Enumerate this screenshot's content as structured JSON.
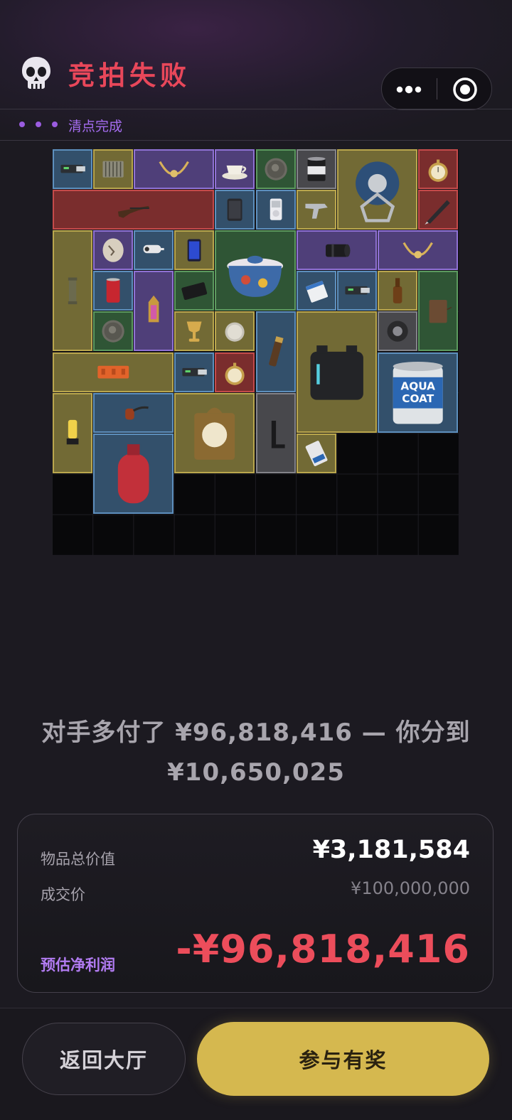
{
  "header": {
    "title": "竞拍失败",
    "skull_icon": "skull-icon",
    "title_color": "#e8475a"
  },
  "capsule": {
    "more_icon": "more-dots-icon",
    "close_icon": "target-close-icon"
  },
  "status": {
    "text": "清点完成",
    "dot_color": "#9b5ce0"
  },
  "grid": {
    "columns": 10,
    "rows": 10,
    "tier_colors": {
      "blue": "#5d8fbd",
      "gold": "#b9a64d",
      "purple": "#8f71d4",
      "green": "#5c9a5f",
      "red": "#c44a4a",
      "gray": "#838389"
    },
    "items": [
      {
        "name": "usb-drive",
        "tier": "blue"
      },
      {
        "name": "circuit-board",
        "tier": "gold"
      },
      {
        "name": "horn-necklace",
        "tier": "purple"
      },
      {
        "name": "teacup",
        "tier": "purple"
      },
      {
        "name": "old-coin",
        "tier": "green"
      },
      {
        "name": "paint-can-small",
        "tier": "gray"
      },
      {
        "name": "cable-reel",
        "tier": "gold"
      },
      {
        "name": "pocket-watch",
        "tier": "red"
      },
      {
        "name": "flintlock-rifle",
        "tier": "red"
      },
      {
        "name": "smartphone",
        "tier": "blue"
      },
      {
        "name": "mp3-player",
        "tier": "blue"
      },
      {
        "name": "hot-glue-gun",
        "tier": "gold"
      },
      {
        "name": "fountain-pen",
        "tier": "red"
      },
      {
        "name": "drawing-tube",
        "tier": "gold"
      },
      {
        "name": "fossil-egg",
        "tier": "purple"
      },
      {
        "name": "security-camera",
        "tier": "blue"
      },
      {
        "name": "phone-dark",
        "tier": "gold"
      },
      {
        "name": "ceramic-pot",
        "tier": "green"
      },
      {
        "name": "camera-lens",
        "tier": "purple"
      },
      {
        "name": "horn-necklace-2",
        "tier": "purple"
      },
      {
        "name": "soda-can",
        "tier": "blue"
      },
      {
        "name": "ornate-lantern",
        "tier": "purple"
      },
      {
        "name": "black-card",
        "tier": "green"
      },
      {
        "name": "cigarette-pack",
        "tier": "blue"
      },
      {
        "name": "usb-drive-2",
        "tier": "blue"
      },
      {
        "name": "small-bottle",
        "tier": "gold"
      },
      {
        "name": "leather-notebook",
        "tier": "green"
      },
      {
        "name": "coin-2",
        "tier": "green"
      },
      {
        "name": "gold-chalice",
        "tier": "gold"
      },
      {
        "name": "compact-mirror",
        "tier": "gold"
      },
      {
        "name": "spyglass",
        "tier": "blue"
      },
      {
        "name": "power-station",
        "tier": "gold"
      },
      {
        "name": "duct-tape",
        "tier": "gray"
      },
      {
        "name": "orange-case",
        "tier": "gold"
      },
      {
        "name": "usb-drive-3",
        "tier": "blue"
      },
      {
        "name": "pocket-watch-2",
        "tier": "red"
      },
      {
        "name": "paint-bucket",
        "tier": "blue"
      },
      {
        "name": "oil-lamp",
        "tier": "gold"
      },
      {
        "name": "tobacco-pipe",
        "tier": "blue"
      },
      {
        "name": "mantel-clock",
        "tier": "gold"
      },
      {
        "name": "black-bracket",
        "tier": "gray"
      },
      {
        "name": "memory-stick",
        "tier": "gold"
      },
      {
        "name": "gas-cylinder",
        "tier": "blue"
      }
    ],
    "paint_label_1": "AQUA",
    "paint_label_2": "COAT"
  },
  "summary": {
    "line": "对手多付了 ¥96,818,416 — 你分到 ¥10,650,025"
  },
  "stats": {
    "total_label": "物品总价值",
    "total_value": "¥3,181,584",
    "price_label": "成交价",
    "price_value": "¥100,000,000",
    "profit_label": "预估净利润",
    "profit_value": "-¥96,818,416",
    "loss_color": "#ec4d5b"
  },
  "buttons": {
    "back": "返回大厅",
    "join": "参与有奖",
    "join_color": "#d5b84f"
  }
}
